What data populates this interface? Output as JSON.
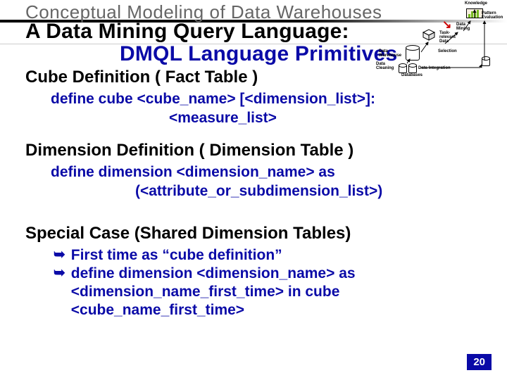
{
  "super_title": "Conceptual Modeling of Data Warehouses",
  "title_line1": "A Data Mining Query Language:",
  "title_line2": "DMQL Language Primitives",
  "sections": {
    "cube": {
      "heading": "Cube Definition ( Fact Table )",
      "code_line1": "define cube <cube_name> [<dimension_list>]:",
      "code_line2": "<measure_list>"
    },
    "dim": {
      "heading": "Dimension Definition ( Dimension Table )",
      "code_line1": "define dimension <dimension_name> as",
      "code_line2": "(<attribute_or_subdimension_list>)"
    },
    "special": {
      "heading": "Special Case (Shared Dimension Tables)",
      "bullet1": "First time as “cube definition”",
      "bullet2": "define dimension <dimension_name> as <dimension_name_first_time> in cube <cube_name_first_time>"
    }
  },
  "diagram": {
    "knowledge": "Knowledge",
    "pattern": "Pattern Evaluation",
    "mining": "Data Mining",
    "task": "Task-relevant Data",
    "warehouse": "Data Warehouse",
    "selection": "Selection",
    "cleaning": "Data Cleaning",
    "integration": "Data Integration",
    "databases": "Databases"
  },
  "page_number": "20",
  "bullet_glyph": "➥"
}
